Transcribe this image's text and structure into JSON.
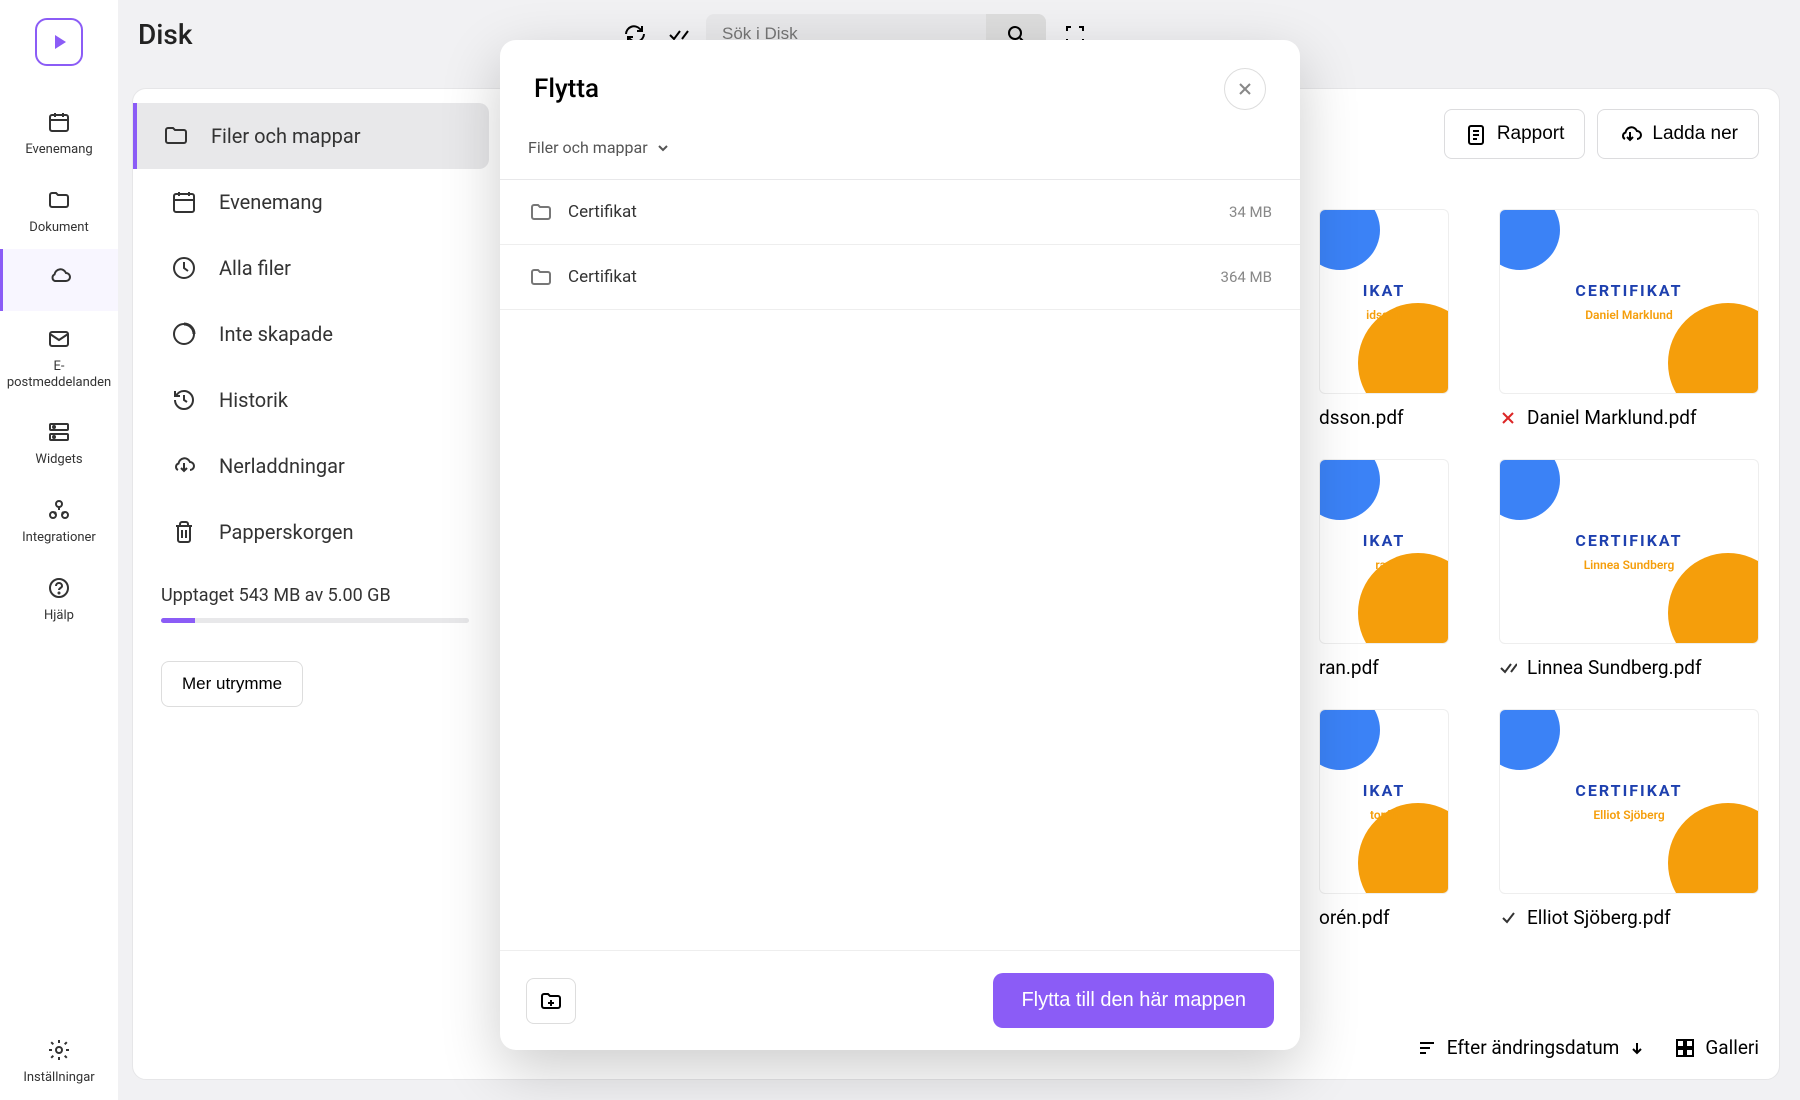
{
  "page_title": "Disk",
  "search": {
    "placeholder": "Sök i Disk"
  },
  "rail": {
    "items": [
      {
        "label": "Evenemang"
      },
      {
        "label": "Dokument"
      },
      {
        "label": ""
      },
      {
        "label": "E-postmeddelanden"
      },
      {
        "label": "Widgets"
      },
      {
        "label": "Integrationer"
      },
      {
        "label": "Hjälp"
      }
    ],
    "settings_label": "Inställningar"
  },
  "sidebar": {
    "items": [
      {
        "label": "Filer och mappar"
      },
      {
        "label": "Evenemang"
      },
      {
        "label": "Alla filer"
      },
      {
        "label": "Inte skapade"
      },
      {
        "label": "Historik"
      },
      {
        "label": "Nerladdningar"
      },
      {
        "label": "Papperskorgen"
      }
    ],
    "storage_text": "Upptaget 543 MB av 5.00 GB",
    "more_space_label": "Mer utrymme"
  },
  "header_actions": {
    "report_label": "Rapport",
    "download_label": "Ladda ner"
  },
  "files": [
    {
      "name": "dsson.pdf",
      "cert_name": "idsson",
      "status": "partial"
    },
    {
      "name": "Daniel Marklund.pdf",
      "cert_name": "Daniel Marklund",
      "status": "error"
    },
    {
      "name": "ran.pdf",
      "cert_name": "ran",
      "status": "partial"
    },
    {
      "name": "Linnea Sundberg.pdf",
      "cert_name": "Linnea Sundberg",
      "status": "ok"
    },
    {
      "name": "orén.pdf",
      "cert_name": "torén",
      "status": "partial"
    },
    {
      "name": "Elliot Sjöberg.pdf",
      "cert_name": "Elliot Sjöberg",
      "status": "ok"
    }
  ],
  "cert_badge": "CERTIFIKAT",
  "bottom": {
    "sort_label": "Efter ändringsdatum",
    "view_label": "Galleri"
  },
  "modal": {
    "title": "Flytta",
    "breadcrumb": "Filer och mappar",
    "folders": [
      {
        "name": "Certifikat",
        "size": "34 MB"
      },
      {
        "name": "Certifikat",
        "size": "364 MB"
      }
    ],
    "move_button": "Flytta till den här mappen"
  }
}
